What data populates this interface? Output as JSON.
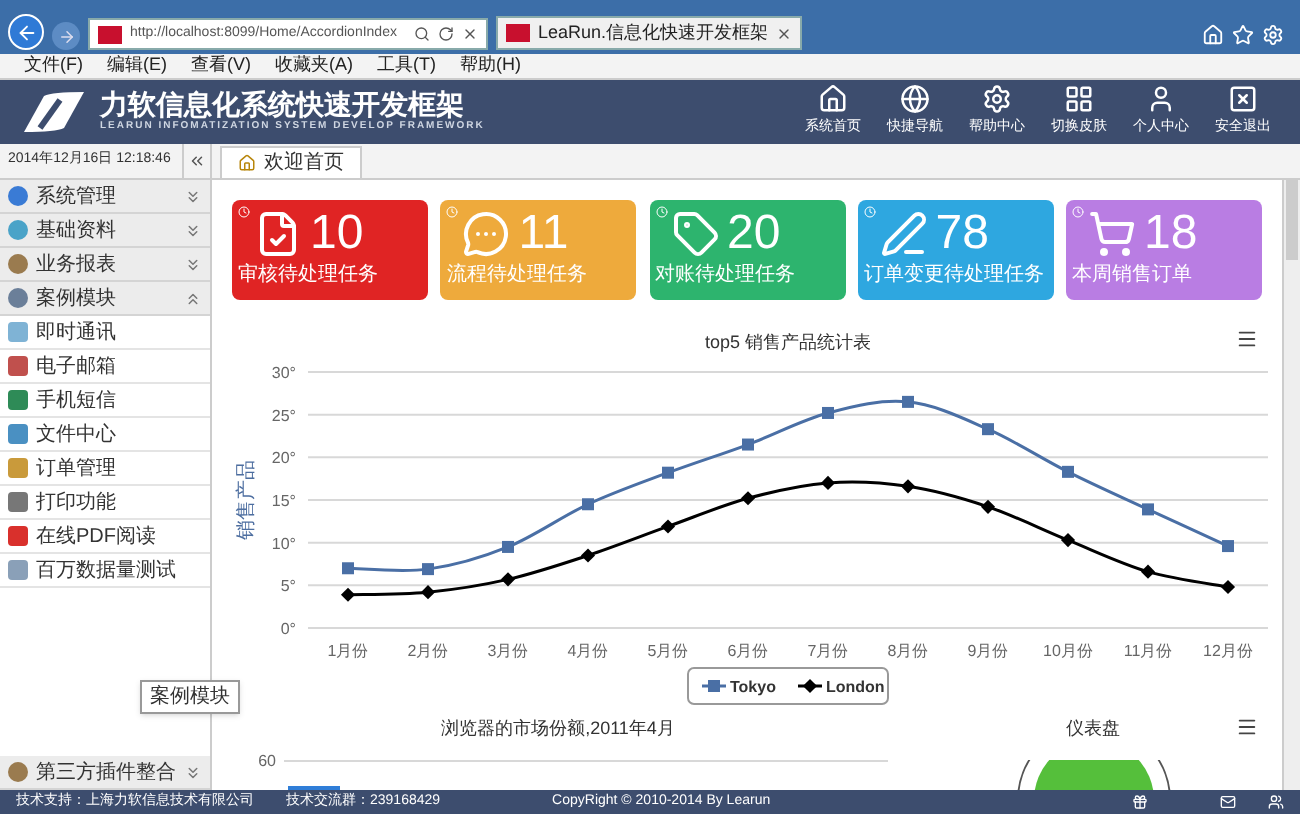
{
  "browser": {
    "address": "http://localhost:8099/Home/AccordionIndex",
    "tab": "LeaRun.信息化快速开发框架",
    "menu": [
      "文件(F)",
      "编辑(E)",
      "查看(V)",
      "收藏夹(A)",
      "工具(T)",
      "帮助(H)"
    ]
  },
  "header": {
    "title": "力软信息化系统快速开发框架",
    "subtitle": "LEARUN INFOMATIZATION SYSTEM DEVELOP FRAMEWORK",
    "nav": [
      "系统首页",
      "快捷导航",
      "帮助中心",
      "切换皮肤",
      "个人中心",
      "安全退出"
    ]
  },
  "sidebar": {
    "datetime": "2014年12月16日 12:18:46",
    "groups": [
      {
        "label": "系统管理",
        "expanded": false
      },
      {
        "label": "基础资料",
        "expanded": false
      },
      {
        "label": "业务报表",
        "expanded": false
      },
      {
        "label": "案例模块",
        "expanded": true,
        "children": [
          {
            "label": "即时通讯"
          },
          {
            "label": "电子邮箱"
          },
          {
            "label": "手机短信"
          },
          {
            "label": "文件中心"
          },
          {
            "label": "订单管理"
          },
          {
            "label": "打印功能"
          },
          {
            "label": "在线PDF阅读"
          },
          {
            "label": "百万数据量测试"
          }
        ]
      }
    ],
    "bottom_group": {
      "label": "第三方插件整合",
      "expanded": false
    },
    "tooltip": "案例模块"
  },
  "tabs": [
    {
      "label": "欢迎首页",
      "selected": true
    }
  ],
  "cards": [
    {
      "count": "10",
      "label": "审核待处理任务",
      "color": "#e02424"
    },
    {
      "count": "11",
      "label": "流程待处理任务",
      "color": "#eeaa3c"
    },
    {
      "count": "20",
      "label": "对账待处理任务",
      "color": "#2db46e"
    },
    {
      "count": "78",
      "label": "订单变更待处理任务",
      "color": "#2ea7e0"
    },
    {
      "count": "18",
      "label": "本周销售订单",
      "color": "#b97de3"
    }
  ],
  "line_chart": {
    "chart_data": {
      "type": "line",
      "title": "top5 销售产品统计表",
      "ylabel": "销售产品",
      "categories": [
        "1月份",
        "2月份",
        "3月份",
        "4月份",
        "5月份",
        "6月份",
        "7月份",
        "8月份",
        "9月份",
        "10月份",
        "11月份",
        "12月份"
      ],
      "series": [
        {
          "name": "Tokyo",
          "color": "#4a6fa5",
          "marker": "square",
          "values": [
            7.0,
            6.9,
            9.5,
            14.5,
            18.2,
            21.5,
            25.2,
            26.5,
            23.3,
            18.3,
            13.9,
            9.6
          ]
        },
        {
          "name": "London",
          "color": "#000000",
          "marker": "diamond",
          "values": [
            3.9,
            4.2,
            5.7,
            8.5,
            11.9,
            15.2,
            17.0,
            16.6,
            14.2,
            10.3,
            6.6,
            4.8
          ]
        }
      ],
      "grid": true,
      "legend": true,
      "ylim": [
        0,
        30
      ],
      "yticks": [
        {
          "value": 0,
          "label": "0°"
        },
        {
          "value": 5,
          "label": "5°"
        },
        {
          "value": 10,
          "label": "10°"
        },
        {
          "value": 15,
          "label": "15°"
        },
        {
          "value": 20,
          "label": "20°"
        },
        {
          "value": 25,
          "label": "25°"
        },
        {
          "value": 30,
          "label": "30°"
        }
      ]
    }
  },
  "bar_chart": {
    "title": "浏览器的市场份额,2011年4月",
    "tick": "60"
  },
  "gauge": {
    "title": "仪表盘"
  },
  "footer": {
    "support": "技术支持：上海力软信息技术有限公司",
    "group": "技术交流群：239168429",
    "copyright": "CopyRight © 2010-2014 By Learun"
  }
}
